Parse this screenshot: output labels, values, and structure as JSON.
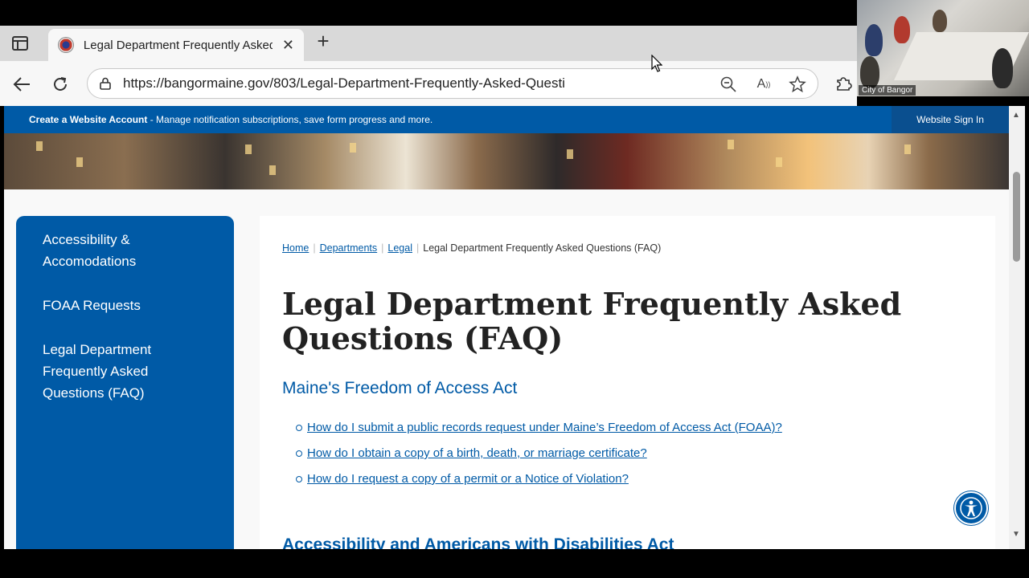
{
  "browser": {
    "tab_title": "Legal Department Frequently Asked Questions (FAQ)",
    "url": "https://bangormaine.gov/803/Legal-Department-Frequently-Asked-Questi"
  },
  "video": {
    "label": "City of Bangor"
  },
  "topbar": {
    "create_account": "Create a Website Account",
    "create_account_desc": " - Manage notification subscriptions, save form progress and more.",
    "sign_in": "Website Sign In"
  },
  "sidebar": {
    "items": [
      {
        "label": "Accessibility & Accomodations"
      },
      {
        "label": "FOAA Requests"
      },
      {
        "label": "Legal Department Frequently Asked Questions (FAQ)"
      }
    ]
  },
  "breadcrumb": {
    "home": "Home",
    "departments": "Departments",
    "legal": "Legal",
    "current": "Legal Department Frequently Asked Questions (FAQ)"
  },
  "main": {
    "title": "Legal Department Frequently Asked Questions (FAQ)",
    "section1": "Maine's Freedom of Access Act",
    "faqs": [
      "How do I submit a public records request under Maine’s Freedom of Access Act (FOAA)?",
      "How do I obtain a copy of a birth, death, or marriage certificate?",
      "How do I request a copy of a permit or a Notice of Violation?"
    ],
    "section2": "Accessibility and Americans with Disabilities Act"
  },
  "colors": {
    "brand_blue": "#005aa6",
    "sign_in_bg": "#0a4f8f"
  }
}
